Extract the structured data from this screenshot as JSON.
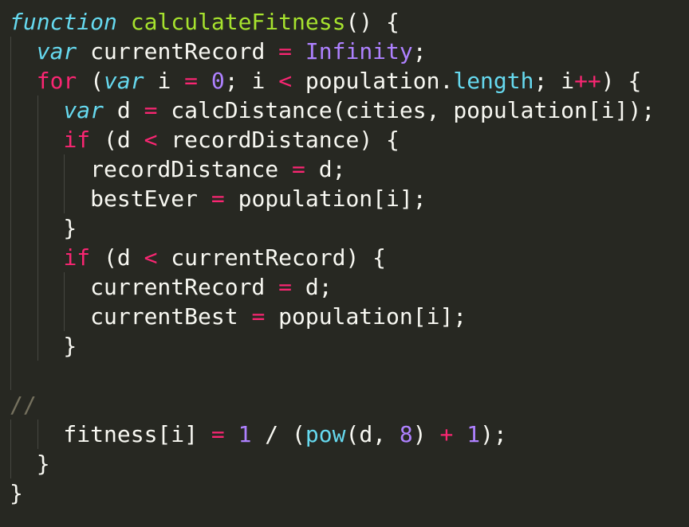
{
  "editor": {
    "theme": {
      "background": "#272822",
      "foreground": "#f8f8f2",
      "keyword": "#f92672",
      "storage": "#66d9ef",
      "function_name": "#a6e22e",
      "number": "#ae81ff",
      "comment": "#75715e",
      "indent_guide": "#464741"
    },
    "lines": [
      {
        "tokens": [
          {
            "t": "function",
            "c": "st"
          },
          {
            "t": " ",
            "c": "pl"
          },
          {
            "t": "calculateFitness",
            "c": "fn"
          },
          {
            "t": "() {",
            "c": "pl"
          }
        ]
      },
      {
        "tokens": [
          {
            "t": "  ",
            "c": "pl"
          },
          {
            "t": "var",
            "c": "st"
          },
          {
            "t": " currentRecord ",
            "c": "pl"
          },
          {
            "t": "=",
            "c": "op"
          },
          {
            "t": " ",
            "c": "pl"
          },
          {
            "t": "Infinity",
            "c": "num"
          },
          {
            "t": ";",
            "c": "pl"
          }
        ]
      },
      {
        "tokens": [
          {
            "t": "  ",
            "c": "pl"
          },
          {
            "t": "for",
            "c": "kw"
          },
          {
            "t": " (",
            "c": "pl"
          },
          {
            "t": "var",
            "c": "st"
          },
          {
            "t": " i ",
            "c": "pl"
          },
          {
            "t": "=",
            "c": "op"
          },
          {
            "t": " ",
            "c": "pl"
          },
          {
            "t": "0",
            "c": "num"
          },
          {
            "t": "; i ",
            "c": "pl"
          },
          {
            "t": "<",
            "c": "op"
          },
          {
            "t": " population.",
            "c": "pl"
          },
          {
            "t": "length",
            "c": "prop"
          },
          {
            "t": "; i",
            "c": "pl"
          },
          {
            "t": "++",
            "c": "op"
          },
          {
            "t": ") {",
            "c": "pl"
          }
        ]
      },
      {
        "tokens": [
          {
            "t": "    ",
            "c": "pl"
          },
          {
            "t": "var",
            "c": "st"
          },
          {
            "t": " d ",
            "c": "pl"
          },
          {
            "t": "=",
            "c": "op"
          },
          {
            "t": " calcDistance(cities, population[i]);",
            "c": "pl"
          }
        ]
      },
      {
        "tokens": [
          {
            "t": "    ",
            "c": "pl"
          },
          {
            "t": "if",
            "c": "kw"
          },
          {
            "t": " (d ",
            "c": "pl"
          },
          {
            "t": "<",
            "c": "op"
          },
          {
            "t": " recordDistance) {",
            "c": "pl"
          }
        ]
      },
      {
        "tokens": [
          {
            "t": "      recordDistance ",
            "c": "pl"
          },
          {
            "t": "=",
            "c": "op"
          },
          {
            "t": " d;",
            "c": "pl"
          }
        ]
      },
      {
        "tokens": [
          {
            "t": "      bestEver ",
            "c": "pl"
          },
          {
            "t": "=",
            "c": "op"
          },
          {
            "t": " population[i];",
            "c": "pl"
          }
        ]
      },
      {
        "tokens": [
          {
            "t": "    }",
            "c": "pl"
          }
        ]
      },
      {
        "tokens": [
          {
            "t": "    ",
            "c": "pl"
          },
          {
            "t": "if",
            "c": "kw"
          },
          {
            "t": " (d ",
            "c": "pl"
          },
          {
            "t": "<",
            "c": "op"
          },
          {
            "t": " currentRecord) {",
            "c": "pl"
          }
        ]
      },
      {
        "tokens": [
          {
            "t": "      currentRecord ",
            "c": "pl"
          },
          {
            "t": "=",
            "c": "op"
          },
          {
            "t": " d;",
            "c": "pl"
          }
        ]
      },
      {
        "tokens": [
          {
            "t": "      currentBest ",
            "c": "pl"
          },
          {
            "t": "=",
            "c": "op"
          },
          {
            "t": " population[i];",
            "c": "pl"
          }
        ]
      },
      {
        "tokens": [
          {
            "t": "    }",
            "c": "pl"
          }
        ]
      },
      {
        "tokens": []
      },
      {
        "tokens": [
          {
            "t": "//",
            "c": "cm"
          }
        ]
      },
      {
        "tokens": [
          {
            "t": "    fitness[i] ",
            "c": "pl"
          },
          {
            "t": "=",
            "c": "op"
          },
          {
            "t": " ",
            "c": "pl"
          },
          {
            "t": "1",
            "c": "num"
          },
          {
            "t": " / (",
            "c": "pl"
          },
          {
            "t": "pow",
            "c": "prop"
          },
          {
            "t": "(d, ",
            "c": "pl"
          },
          {
            "t": "8",
            "c": "num"
          },
          {
            "t": ") ",
            "c": "pl"
          },
          {
            "t": "+",
            "c": "op"
          },
          {
            "t": " ",
            "c": "pl"
          },
          {
            "t": "1",
            "c": "num"
          },
          {
            "t": ");",
            "c": "pl"
          }
        ]
      },
      {
        "tokens": [
          {
            "t": "  }",
            "c": "pl"
          }
        ]
      },
      {
        "tokens": [
          {
            "t": "}",
            "c": "pl"
          }
        ]
      }
    ]
  }
}
